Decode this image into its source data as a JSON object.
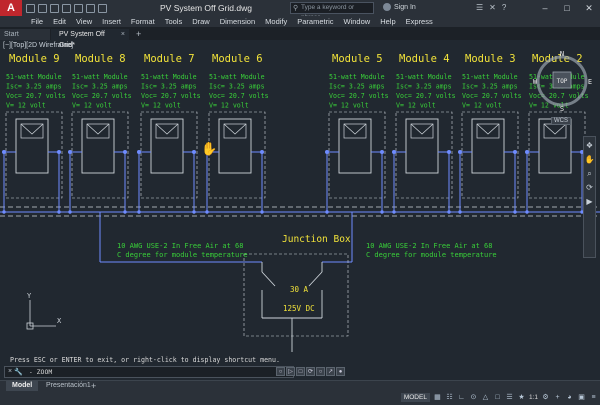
{
  "app": {
    "logo_letter": "A",
    "title": "PV System Off Grid.dwg",
    "search_placeholder": "Type a keyword or phrase",
    "signin_label": "Sign In"
  },
  "menus": [
    "File",
    "Edit",
    "View",
    "Insert",
    "Format",
    "Tools",
    "Draw",
    "Dimension",
    "Modify",
    "Parametric",
    "Window",
    "Help",
    "Express"
  ],
  "tabs": {
    "start": "Start",
    "active": "PV System Off Grid*"
  },
  "viewport_label": "[−][Top][2D Wireframe]",
  "modules": [
    {
      "name": "Module 9"
    },
    {
      "name": "Module 8"
    },
    {
      "name": "Module 7"
    },
    {
      "name": "Module 6"
    },
    {
      "name": "Module 5"
    },
    {
      "name": "Module 4"
    },
    {
      "name": "Module 3"
    },
    {
      "name": "Module 2"
    }
  ],
  "module_specs": {
    "watt": "51-watt Module",
    "isc": "Isc= 3.25 amps",
    "voc": "Voc= 20.7 volts",
    "v": "V= 12 volt"
  },
  "junction_box": {
    "title": "Junction Box",
    "fuse": "30 A",
    "voltage": "125V DC"
  },
  "wire_note": {
    "line1": "10 AWG USE-2 In Free Air at 68",
    "line2": "C degree for module temperature"
  },
  "viewcube": {
    "top": "TOP",
    "n": "N",
    "s": "S",
    "e": "E",
    "w": "W",
    "wcs": "WCS"
  },
  "ucs": {
    "x": "X",
    "y": "Y"
  },
  "command": {
    "history": "Press ESC or ENTER to exit, or right-click to display shortcut menu.",
    "prompt": "- ZOOM"
  },
  "layout_tabs": {
    "model": "Model",
    "presentation": "Presentación1"
  },
  "status": {
    "model": "MODEL",
    "scale": "1:1"
  },
  "colors": {
    "background": "#212830",
    "module_green": "#39d039",
    "title_yellow": "#f2e33a",
    "wire_blue": "#6f8cff",
    "grid_white": "#cfd5db"
  }
}
